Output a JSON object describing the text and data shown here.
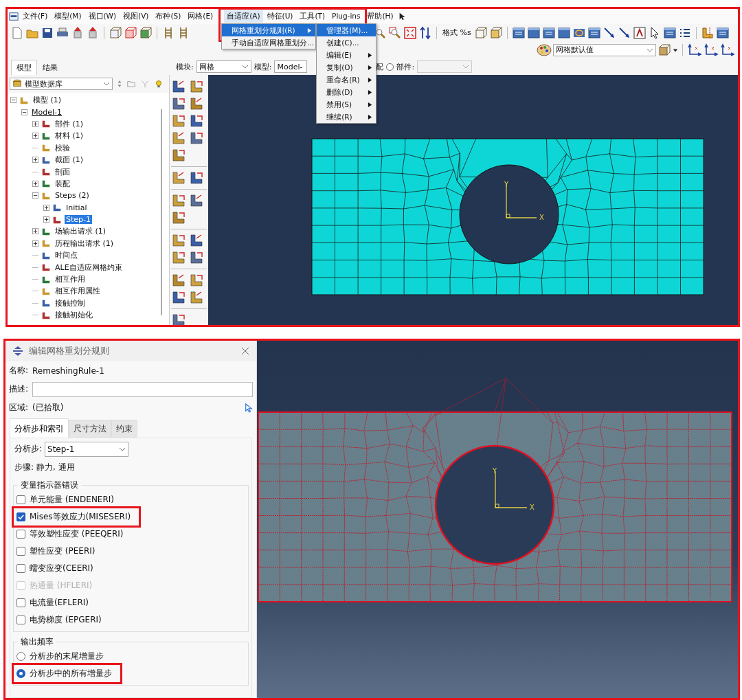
{
  "top": {
    "menu_bar": [
      {
        "label": "文件(F)",
        "selected": false
      },
      {
        "label": "模型(M)",
        "selected": false
      },
      {
        "label": "视口(W)",
        "selected": false
      },
      {
        "label": "视图(V)",
        "selected": false
      },
      {
        "label": "布种(S)",
        "selected": false
      },
      {
        "label": "网格(E)",
        "selected": false
      },
      {
        "label": "自适应(A)",
        "selected": true
      },
      {
        "label": "特征(U)",
        "selected": false
      },
      {
        "label": "工具(T)",
        "selected": false
      },
      {
        "label": "Plug-ins",
        "selected": false
      },
      {
        "label": "帮助(H)",
        "selected": false
      }
    ],
    "adaptivity_menu": [
      {
        "label": "网格重划分规则(R)",
        "submenu": true,
        "selected": true
      },
      {
        "label": "手动自适应网格重划分...",
        "submenu": false,
        "selected": false
      }
    ],
    "remeshing_submenu": [
      {
        "label": "管理器(M)...",
        "submenu": false,
        "selected": true
      },
      {
        "label": "创建(C)...",
        "submenu": false,
        "selected": false
      },
      {
        "label": "编辑(E)",
        "submenu": true,
        "selected": false
      },
      {
        "label": "复制(O)",
        "submenu": true,
        "selected": false
      },
      {
        "label": "重命名(R)",
        "submenu": true,
        "selected": false
      },
      {
        "label": "删除(D)",
        "submenu": true,
        "selected": false
      },
      {
        "label": "禁用(S)",
        "submenu": true,
        "selected": false
      },
      {
        "label": "继续(R)",
        "submenu": true,
        "selected": false
      }
    ],
    "format_label": "格式 %s",
    "render_style": "网格默认值",
    "tabs": [
      {
        "label": "模型",
        "selected": true
      },
      {
        "label": "结果",
        "selected": false
      }
    ],
    "database": "模型数据库",
    "context": {
      "module_label": "模块:",
      "module": "网格",
      "model_label": "模型:",
      "model": "Model-",
      "assembly_label": "配",
      "part_selected": false,
      "part_label": "部件:"
    },
    "tree": [
      {
        "label": "模型 (1)",
        "expanded": true,
        "selected": false,
        "current": false,
        "children": [
          {
            "label": "Model-1",
            "expanded": true,
            "selected": false,
            "current": true,
            "children": [
              {
                "label": "部件 (1)",
                "expanded": false,
                "selected": false,
                "current": false
              },
              {
                "label": "材料 (1)",
                "expanded": false,
                "selected": false,
                "current": false
              },
              {
                "label": "校验",
                "selected": false,
                "current": false
              },
              {
                "label": "截面 (1)",
                "expanded": false,
                "selected": false,
                "current": false
              },
              {
                "label": "剖面",
                "selected": false,
                "current": false
              },
              {
                "label": "装配",
                "expanded": false,
                "selected": false,
                "current": false
              },
              {
                "label": "Steps (2)",
                "expanded": true,
                "selected": false,
                "current": false,
                "children": [
                  {
                    "label": "Initial",
                    "expanded": false,
                    "selected": false,
                    "current": false
                  },
                  {
                    "label": "Step-1",
                    "expanded": false,
                    "selected": true,
                    "current": false
                  }
                ]
              },
              {
                "label": "场输出请求 (1)",
                "expanded": false,
                "selected": false,
                "current": false
              },
              {
                "label": "历程输出请求 (1)",
                "expanded": false,
                "selected": false,
                "current": false
              },
              {
                "label": "时间点",
                "selected": false,
                "current": false
              },
              {
                "label": "ALE自适应网格约束",
                "selected": false,
                "current": false
              },
              {
                "label": "相互作用",
                "selected": false,
                "current": false
              },
              {
                "label": "相互作用属性",
                "selected": false,
                "current": false
              },
              {
                "label": "接触控制",
                "selected": false,
                "current": false
              },
              {
                "label": "接触初始化",
                "selected": false,
                "current": false
              }
            ]
          }
        ]
      }
    ],
    "axis_x": "X",
    "axis_y": "Y"
  },
  "dialog": {
    "title": "编辑网格重划分规则",
    "name_label": "名称:",
    "name": "RemeshingRule-1",
    "description_label": "描述:",
    "region_label": "区域:",
    "region": "(已拾取)",
    "tabs": [
      {
        "label": "分析步和索引",
        "selected": true
      },
      {
        "label": "尺寸方法",
        "selected": false
      },
      {
        "label": "约束",
        "selected": false
      }
    ],
    "step_label": "分析步:",
    "step": "Step-1",
    "procedure_label": "步骤:",
    "procedure": "静力, 通用",
    "indicator_group": "变量指示器错误",
    "indicators": [
      {
        "label": "单元能量 (ENDENERI)",
        "checked": false,
        "disabled": false,
        "highlighted": false
      },
      {
        "label": "Mises等效应力(MISESERI)",
        "checked": true,
        "disabled": false,
        "highlighted": true
      },
      {
        "label": "等效塑性应变 (PEEQERI)",
        "checked": false,
        "disabled": false,
        "highlighted": false
      },
      {
        "label": "塑性应变 (PEERI)",
        "checked": false,
        "disabled": false,
        "highlighted": false
      },
      {
        "label": "蠕变应变(CEERI)",
        "checked": false,
        "disabled": false,
        "highlighted": false
      },
      {
        "label": "热通量 (HFLERI)",
        "checked": false,
        "disabled": true,
        "highlighted": false
      },
      {
        "label": "电流量(EFLERI)",
        "checked": false,
        "disabled": false,
        "highlighted": false
      },
      {
        "label": "电势梯度 (EPGERI)",
        "checked": false,
        "disabled": false,
        "highlighted": false
      }
    ],
    "frequency_group": "输出频率",
    "frequencies": [
      {
        "label": "分析步的末尾增量步",
        "selected": false,
        "highlighted": false
      },
      {
        "label": "分析步中的所有增量步",
        "selected": true,
        "highlighted": true
      }
    ]
  },
  "bottom": {
    "axis_x": "X",
    "axis_y": "Y"
  }
}
